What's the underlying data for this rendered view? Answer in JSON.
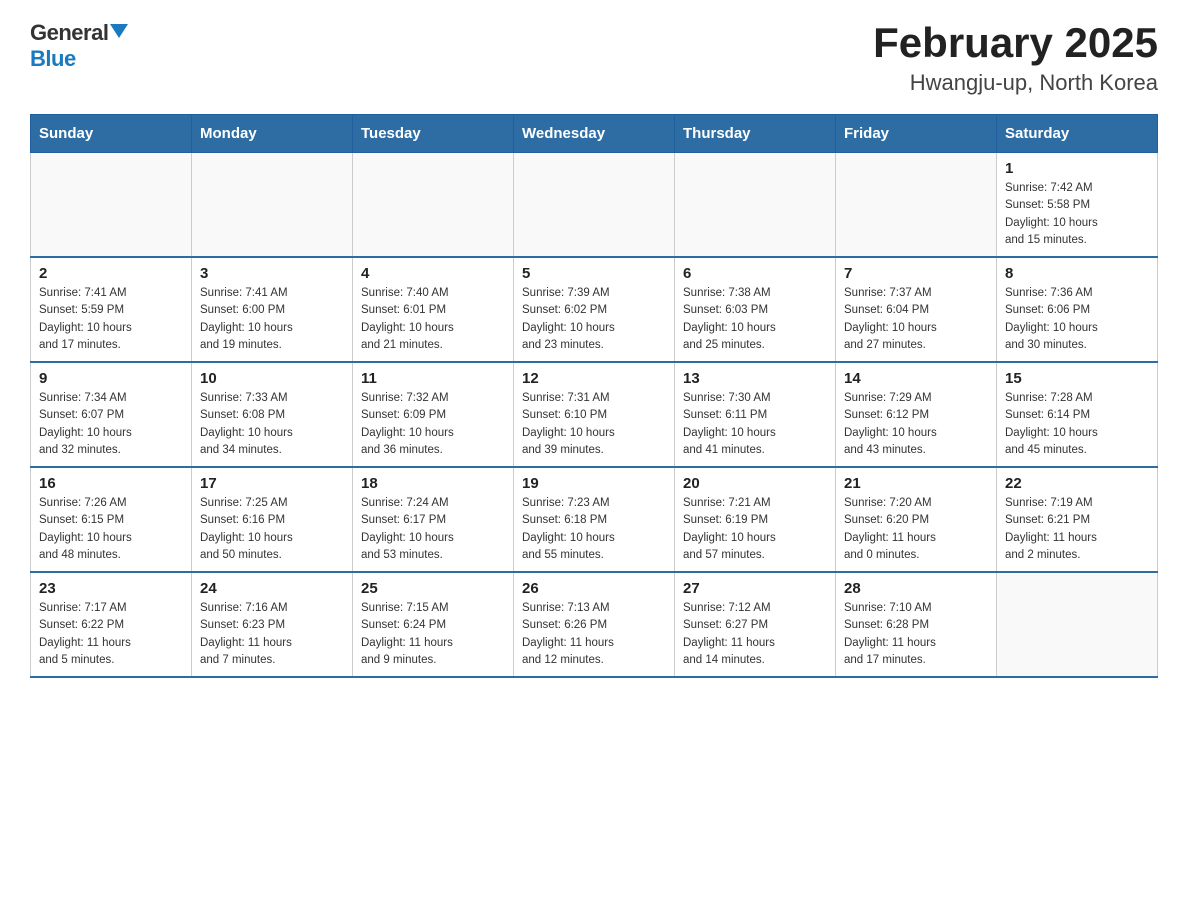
{
  "header": {
    "logo_general": "General",
    "logo_blue": "Blue",
    "title": "February 2025",
    "subtitle": "Hwangju-up, North Korea"
  },
  "weekdays": [
    "Sunday",
    "Monday",
    "Tuesday",
    "Wednesday",
    "Thursday",
    "Friday",
    "Saturday"
  ],
  "weeks": [
    [
      {
        "day": "",
        "info": ""
      },
      {
        "day": "",
        "info": ""
      },
      {
        "day": "",
        "info": ""
      },
      {
        "day": "",
        "info": ""
      },
      {
        "day": "",
        "info": ""
      },
      {
        "day": "",
        "info": ""
      },
      {
        "day": "1",
        "info": "Sunrise: 7:42 AM\nSunset: 5:58 PM\nDaylight: 10 hours\nand 15 minutes."
      }
    ],
    [
      {
        "day": "2",
        "info": "Sunrise: 7:41 AM\nSunset: 5:59 PM\nDaylight: 10 hours\nand 17 minutes."
      },
      {
        "day": "3",
        "info": "Sunrise: 7:41 AM\nSunset: 6:00 PM\nDaylight: 10 hours\nand 19 minutes."
      },
      {
        "day": "4",
        "info": "Sunrise: 7:40 AM\nSunset: 6:01 PM\nDaylight: 10 hours\nand 21 minutes."
      },
      {
        "day": "5",
        "info": "Sunrise: 7:39 AM\nSunset: 6:02 PM\nDaylight: 10 hours\nand 23 minutes."
      },
      {
        "day": "6",
        "info": "Sunrise: 7:38 AM\nSunset: 6:03 PM\nDaylight: 10 hours\nand 25 minutes."
      },
      {
        "day": "7",
        "info": "Sunrise: 7:37 AM\nSunset: 6:04 PM\nDaylight: 10 hours\nand 27 minutes."
      },
      {
        "day": "8",
        "info": "Sunrise: 7:36 AM\nSunset: 6:06 PM\nDaylight: 10 hours\nand 30 minutes."
      }
    ],
    [
      {
        "day": "9",
        "info": "Sunrise: 7:34 AM\nSunset: 6:07 PM\nDaylight: 10 hours\nand 32 minutes."
      },
      {
        "day": "10",
        "info": "Sunrise: 7:33 AM\nSunset: 6:08 PM\nDaylight: 10 hours\nand 34 minutes."
      },
      {
        "day": "11",
        "info": "Sunrise: 7:32 AM\nSunset: 6:09 PM\nDaylight: 10 hours\nand 36 minutes."
      },
      {
        "day": "12",
        "info": "Sunrise: 7:31 AM\nSunset: 6:10 PM\nDaylight: 10 hours\nand 39 minutes."
      },
      {
        "day": "13",
        "info": "Sunrise: 7:30 AM\nSunset: 6:11 PM\nDaylight: 10 hours\nand 41 minutes."
      },
      {
        "day": "14",
        "info": "Sunrise: 7:29 AM\nSunset: 6:12 PM\nDaylight: 10 hours\nand 43 minutes."
      },
      {
        "day": "15",
        "info": "Sunrise: 7:28 AM\nSunset: 6:14 PM\nDaylight: 10 hours\nand 45 minutes."
      }
    ],
    [
      {
        "day": "16",
        "info": "Sunrise: 7:26 AM\nSunset: 6:15 PM\nDaylight: 10 hours\nand 48 minutes."
      },
      {
        "day": "17",
        "info": "Sunrise: 7:25 AM\nSunset: 6:16 PM\nDaylight: 10 hours\nand 50 minutes."
      },
      {
        "day": "18",
        "info": "Sunrise: 7:24 AM\nSunset: 6:17 PM\nDaylight: 10 hours\nand 53 minutes."
      },
      {
        "day": "19",
        "info": "Sunrise: 7:23 AM\nSunset: 6:18 PM\nDaylight: 10 hours\nand 55 minutes."
      },
      {
        "day": "20",
        "info": "Sunrise: 7:21 AM\nSunset: 6:19 PM\nDaylight: 10 hours\nand 57 minutes."
      },
      {
        "day": "21",
        "info": "Sunrise: 7:20 AM\nSunset: 6:20 PM\nDaylight: 11 hours\nand 0 minutes."
      },
      {
        "day": "22",
        "info": "Sunrise: 7:19 AM\nSunset: 6:21 PM\nDaylight: 11 hours\nand 2 minutes."
      }
    ],
    [
      {
        "day": "23",
        "info": "Sunrise: 7:17 AM\nSunset: 6:22 PM\nDaylight: 11 hours\nand 5 minutes."
      },
      {
        "day": "24",
        "info": "Sunrise: 7:16 AM\nSunset: 6:23 PM\nDaylight: 11 hours\nand 7 minutes."
      },
      {
        "day": "25",
        "info": "Sunrise: 7:15 AM\nSunset: 6:24 PM\nDaylight: 11 hours\nand 9 minutes."
      },
      {
        "day": "26",
        "info": "Sunrise: 7:13 AM\nSunset: 6:26 PM\nDaylight: 11 hours\nand 12 minutes."
      },
      {
        "day": "27",
        "info": "Sunrise: 7:12 AM\nSunset: 6:27 PM\nDaylight: 11 hours\nand 14 minutes."
      },
      {
        "day": "28",
        "info": "Sunrise: 7:10 AM\nSunset: 6:28 PM\nDaylight: 11 hours\nand 17 minutes."
      },
      {
        "day": "",
        "info": ""
      }
    ]
  ]
}
